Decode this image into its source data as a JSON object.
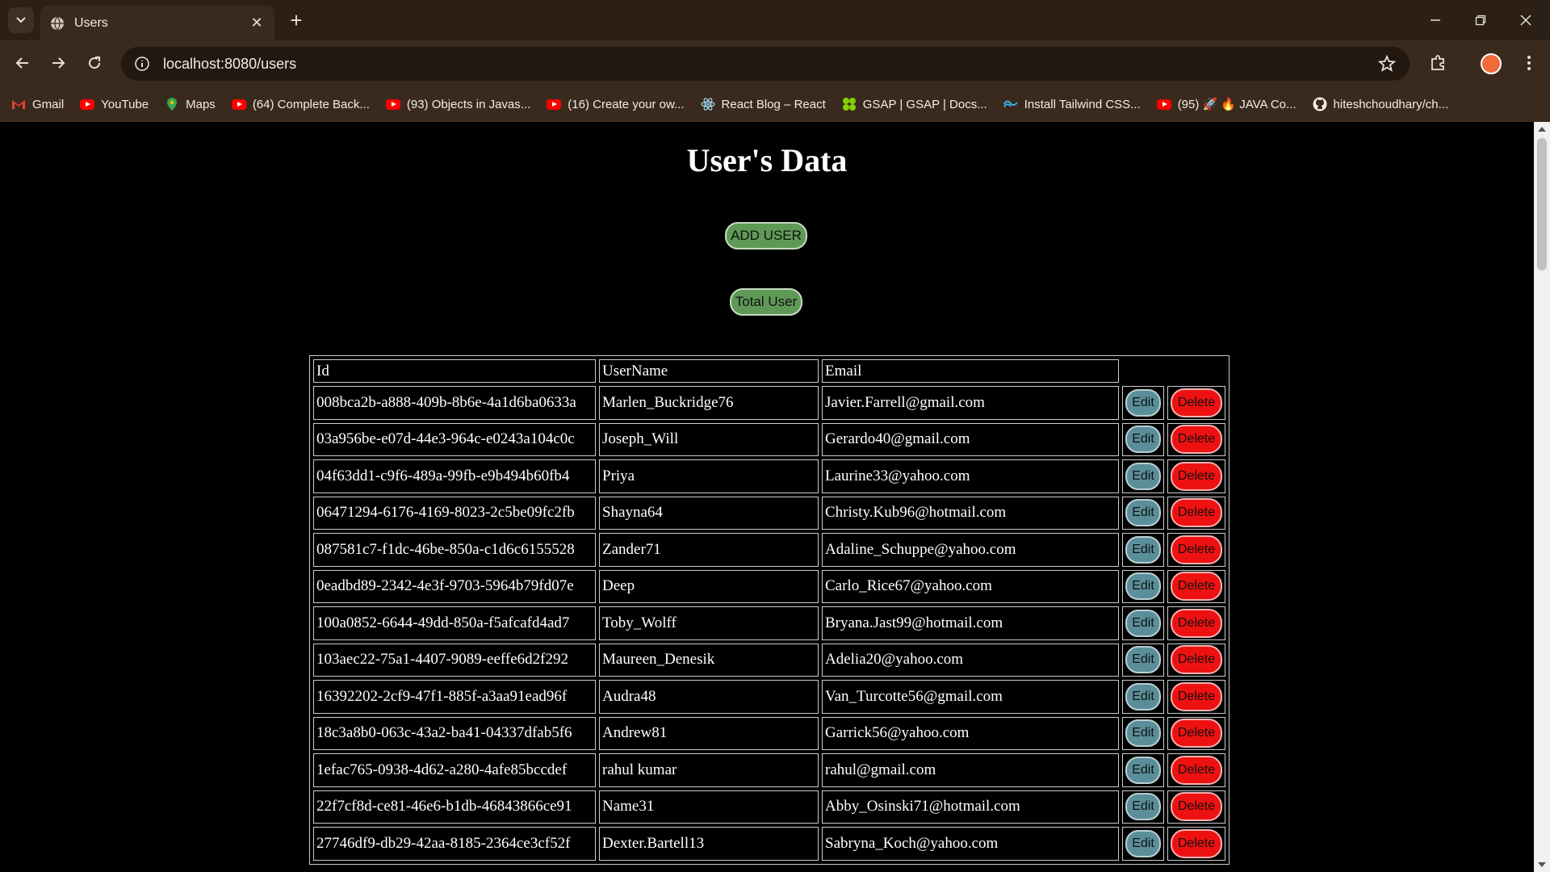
{
  "browser": {
    "tab_title": "Users",
    "url": "localhost:8080/users",
    "bookmarks": [
      {
        "label": "Gmail",
        "icon": "gmail-icon"
      },
      {
        "label": "YouTube",
        "icon": "youtube-icon"
      },
      {
        "label": "Maps",
        "icon": "maps-icon"
      },
      {
        "label": "(64) Complete Back...",
        "icon": "youtube-icon"
      },
      {
        "label": "(93) Objects in Javas...",
        "icon": "youtube-icon"
      },
      {
        "label": "(16) Create your ow...",
        "icon": "youtube-icon"
      },
      {
        "label": "React Blog – React",
        "icon": "react-icon"
      },
      {
        "label": "GSAP | GSAP | Docs...",
        "icon": "gsap-icon"
      },
      {
        "label": "Install Tailwind CSS...",
        "icon": "tailwind-icon"
      },
      {
        "label": "(95) 🚀 🔥 JAVA Co...",
        "icon": "youtube-icon"
      },
      {
        "label": "hiteshchoudhary/ch...",
        "icon": "github-icon"
      }
    ]
  },
  "page": {
    "title": "User's Data",
    "add_user_label": "ADD USER",
    "total_user_label": "Total User",
    "table": {
      "headers": {
        "id": "Id",
        "username": "UserName",
        "email": "Email"
      },
      "edit_label": "Edit",
      "delete_label": "Delete",
      "rows": [
        {
          "id": "008bca2b-a888-409b-8b6e-4a1d6ba0633a",
          "username": "Marlen_Buckridge76",
          "email": "Javier.Farrell@gmail.com"
        },
        {
          "id": "03a956be-e07d-44e3-964c-e0243a104c0c",
          "username": "Joseph_Will",
          "email": "Gerardo40@gmail.com"
        },
        {
          "id": "04f63dd1-c9f6-489a-99fb-e9b494b60fb4",
          "username": "Priya",
          "email": "Laurine33@yahoo.com"
        },
        {
          "id": "06471294-6176-4169-8023-2c5be09fc2fb",
          "username": "Shayna64",
          "email": "Christy.Kub96@hotmail.com"
        },
        {
          "id": "087581c7-f1dc-46be-850a-c1d6c6155528",
          "username": "Zander71",
          "email": "Adaline_Schuppe@yahoo.com"
        },
        {
          "id": "0eadbd89-2342-4e3f-9703-5964b79fd07e",
          "username": "Deep",
          "email": "Carlo_Rice67@yahoo.com"
        },
        {
          "id": "100a0852-6644-49dd-850a-f5afcafd4ad7",
          "username": "Toby_Wolff",
          "email": "Bryana.Jast99@hotmail.com"
        },
        {
          "id": "103aec22-75a1-4407-9089-eeffe6d2f292",
          "username": "Maureen_Denesik",
          "email": "Adelia20@yahoo.com"
        },
        {
          "id": "16392202-2cf9-47f1-885f-a3aa91ead96f",
          "username": "Audra48",
          "email": "Van_Turcotte56@gmail.com"
        },
        {
          "id": "18c3a8b0-063c-43a2-ba41-04337dfab5f6",
          "username": "Andrew81",
          "email": "Garrick56@yahoo.com"
        },
        {
          "id": "1efac765-0938-4d62-a280-4afe85bccdef",
          "username": "rahul kumar",
          "email": "rahul@gmail.com"
        },
        {
          "id": "22f7cf8d-ce81-46e6-b1db-46843866ce91",
          "username": "Name31",
          "email": "Abby_Osinski71@hotmail.com"
        },
        {
          "id": "27746df9-db29-42aa-8185-2364ce3cf52f",
          "username": "Dexter.Bartell13",
          "email": "Sabryna_Koch@yahoo.com"
        }
      ]
    }
  }
}
